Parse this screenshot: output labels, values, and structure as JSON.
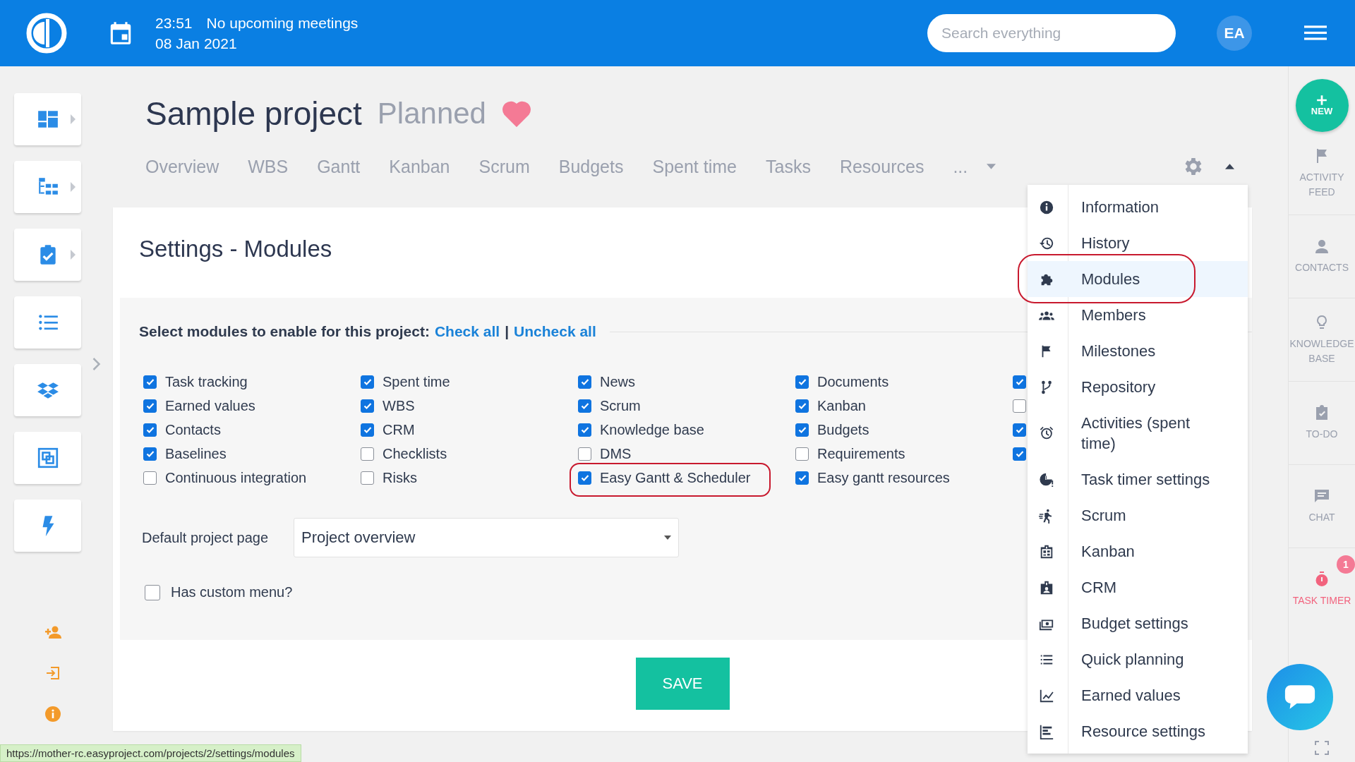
{
  "top_bar": {
    "time": "23:51",
    "meetings": "No upcoming meetings",
    "date": "08 Jan 2021",
    "search": {
      "placeholder": "Search everything"
    },
    "avatar": "EA"
  },
  "left_sidebar": {
    "tiles": [
      {
        "kind": "dashboard",
        "has_submenu": true
      },
      {
        "kind": "tree",
        "has_submenu": true
      },
      {
        "kind": "task",
        "has_submenu": true
      },
      {
        "kind": "list",
        "has_submenu": false
      },
      {
        "kind": "dropbox",
        "has_submenu": false
      },
      {
        "kind": "frame",
        "has_submenu": false
      },
      {
        "kind": "bolt",
        "has_submenu": false
      }
    ],
    "footer": [
      {
        "kind": "add-user"
      },
      {
        "kind": "sign-in"
      },
      {
        "kind": "info"
      }
    ]
  },
  "project": {
    "title": "Sample project",
    "status": "Planned",
    "favorite": true
  },
  "tabs": [
    {
      "label": "Overview",
      "selected": false
    },
    {
      "label": "WBS",
      "selected": false
    },
    {
      "label": "Gantt",
      "selected": false
    },
    {
      "label": "Kanban",
      "selected": false
    },
    {
      "label": "Scrum",
      "selected": false
    },
    {
      "label": "Budgets",
      "selected": false
    },
    {
      "label": "Spent time",
      "selected": false
    },
    {
      "label": "Tasks",
      "selected": false
    },
    {
      "label": "Resources",
      "selected": false
    },
    {
      "label": "...",
      "selected": false
    }
  ],
  "settings": {
    "title": "Settings - Modules",
    "prompt": "Select modules to enable for this project:",
    "check_all": "Check all",
    "separator": "|",
    "uncheck_all": "Uncheck all",
    "module_columns": [
      [
        {
          "label": "Task tracking",
          "checked": true,
          "circled": false
        },
        {
          "label": "Earned values",
          "checked": true,
          "circled": false
        },
        {
          "label": "Contacts",
          "checked": true,
          "circled": false
        },
        {
          "label": "Baselines",
          "checked": true,
          "circled": false
        },
        {
          "label": "Continuous integration",
          "checked": false,
          "circled": false
        }
      ],
      [
        {
          "label": "Spent time",
          "checked": true,
          "circled": false
        },
        {
          "label": "WBS",
          "checked": true,
          "circled": false
        },
        {
          "label": "CRM",
          "checked": true,
          "circled": false
        },
        {
          "label": "Checklists",
          "checked": false,
          "circled": false
        },
        {
          "label": "Risks",
          "checked": false,
          "circled": false
        }
      ],
      [
        {
          "label": "News",
          "checked": true,
          "circled": false
        },
        {
          "label": "Scrum",
          "checked": true,
          "circled": false
        },
        {
          "label": "Knowledge base",
          "checked": true,
          "circled": false
        },
        {
          "label": "DMS",
          "checked": false,
          "circled": false
        },
        {
          "label": "Easy Gantt & Scheduler",
          "checked": true,
          "circled": true
        }
      ],
      [
        {
          "label": "Documents",
          "checked": true,
          "circled": false
        },
        {
          "label": "Kanban",
          "checked": true,
          "circled": false
        },
        {
          "label": "Budgets",
          "checked": true,
          "circled": false
        },
        {
          "label": "Requirements",
          "checked": false,
          "circled": false
        },
        {
          "label": "Easy gantt resources",
          "checked": true,
          "circled": false
        }
      ],
      [
        {
          "checked": true,
          "circled": false
        },
        {
          "checked": false,
          "circled": false
        },
        {
          "checked": true,
          "circled": false
        },
        {
          "checked": true,
          "circled": false
        }
      ]
    ],
    "default_page": {
      "label": "Default project page",
      "value": "Project overview"
    },
    "custom_menu": {
      "label": "Has custom menu?",
      "checked": false
    },
    "save": "SAVE"
  },
  "settings_menu": [
    {
      "label": "Information",
      "kind": "info",
      "selected": false,
      "circled": false
    },
    {
      "label": "History",
      "kind": "history",
      "selected": false,
      "circled": false
    },
    {
      "label": "Modules",
      "kind": "puzzle",
      "selected": true,
      "circled": true
    },
    {
      "label": "Members",
      "kind": "people",
      "selected": false,
      "circled": false
    },
    {
      "label": "Milestones",
      "kind": "flag",
      "selected": false,
      "circled": false
    },
    {
      "label": "Repository",
      "kind": "branch",
      "selected": false,
      "circled": false
    },
    {
      "label": "Activities (spent time)",
      "kind": "alarm",
      "selected": false,
      "circled": false
    },
    {
      "label": "Task timer settings",
      "kind": "clock",
      "selected": false,
      "circled": false
    },
    {
      "label": "Scrum",
      "kind": "runner",
      "selected": false,
      "circled": false
    },
    {
      "label": "Kanban",
      "kind": "board",
      "selected": false,
      "circled": false
    },
    {
      "label": "CRM",
      "kind": "badge",
      "selected": false,
      "circled": false
    },
    {
      "label": "Budget settings",
      "kind": "money",
      "selected": false,
      "circled": false
    },
    {
      "label": "Quick planning",
      "kind": "list",
      "selected": false,
      "circled": false
    },
    {
      "label": "Earned values",
      "kind": "chart",
      "selected": false,
      "circled": false
    },
    {
      "label": "Resource settings",
      "kind": "bars",
      "selected": false,
      "circled": false
    }
  ],
  "right_sidebar": {
    "new": "NEW",
    "items": [
      {
        "label": "ACTIVITY FEED",
        "kind": "flag",
        "alert": false
      },
      {
        "label": "CONTACTS",
        "kind": "person",
        "alert": false
      },
      {
        "label": "KNOWLEDGE BASE",
        "kind": "bulb",
        "alert": false
      },
      {
        "label": "TO-DO",
        "kind": "todo",
        "alert": false
      },
      {
        "label": "CHAT",
        "kind": "chat",
        "alert": false
      },
      {
        "label": "TASK TIMER",
        "kind": "timer",
        "alert": true,
        "badge": "1"
      }
    ]
  },
  "status_url": "https://mother-rc.easyproject.com/projects/2/settings/modules"
}
